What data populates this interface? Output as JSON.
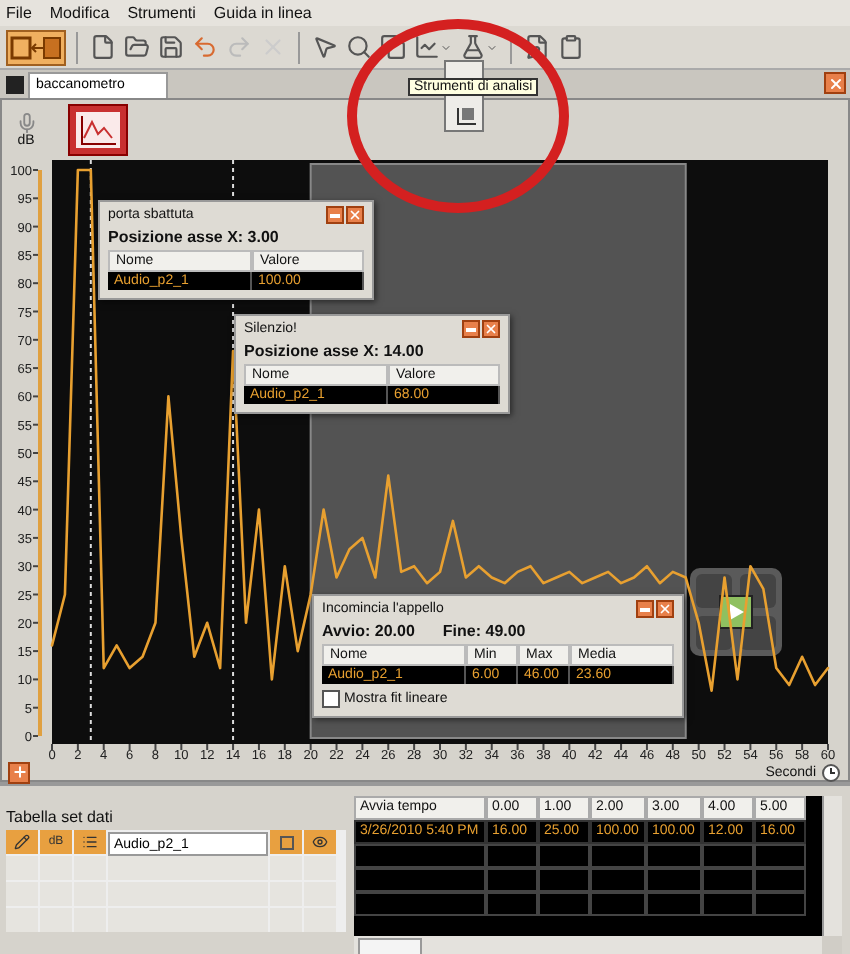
{
  "menu": [
    "File",
    "Modifica",
    "Strumenti",
    "Guida in linea"
  ],
  "toolbar": {
    "tooltip": "Strumenti di analisi"
  },
  "tabs": [
    {
      "label": "baccanometro",
      "selected": true
    }
  ],
  "chart": {
    "unit": "dB",
    "x_unit": "Secondi",
    "chart_data": {
      "type": "line",
      "x": [
        0,
        1,
        2,
        3,
        4,
        5,
        6,
        7,
        8,
        9,
        10,
        11,
        12,
        13,
        14,
        15,
        16,
        17,
        18,
        19,
        20,
        21,
        22,
        23,
        24,
        25,
        26,
        27,
        28,
        29,
        30,
        31,
        32,
        33,
        34,
        35,
        36,
        37,
        38,
        39,
        40,
        41,
        42,
        43,
        44,
        45,
        46,
        47,
        48,
        49,
        50,
        51,
        52,
        53,
        54,
        55,
        56,
        57,
        58,
        59,
        60
      ],
      "xlim": [
        0,
        60
      ],
      "ylim": [
        0,
        100
      ],
      "xticks": [
        0,
        2,
        4,
        6,
        8,
        10,
        12,
        14,
        16,
        18,
        20,
        22,
        24,
        26,
        28,
        30,
        32,
        34,
        36,
        38,
        40,
        42,
        44,
        46,
        48,
        50,
        52,
        54,
        56,
        58,
        60
      ],
      "yticks": [
        0,
        5,
        10,
        15,
        20,
        25,
        30,
        35,
        40,
        45,
        50,
        55,
        60,
        65,
        70,
        75,
        80,
        85,
        90,
        95,
        100
      ],
      "series": [
        {
          "color": "#e8a030",
          "values": [
            16,
            25,
            100,
            100,
            12,
            16,
            12,
            14,
            20,
            60,
            35,
            14,
            20,
            12,
            68,
            20,
            40,
            10,
            30,
            15,
            25,
            40,
            28,
            33,
            35,
            28,
            46,
            29,
            30,
            27,
            29,
            38,
            28,
            30,
            28,
            27,
            29,
            30,
            27,
            28,
            29,
            27,
            28,
            29,
            27,
            28,
            30,
            27,
            29,
            28,
            20,
            8,
            28,
            10,
            30,
            26,
            12,
            9,
            14,
            9,
            12
          ]
        }
      ],
      "ref_lines": [
        {
          "axis": "x",
          "value": 3
        },
        {
          "axis": "x",
          "value": 14
        }
      ],
      "bands": [
        {
          "axis": "x",
          "from": 20,
          "to": 49
        }
      ]
    }
  },
  "popups": [
    {
      "kind": "point",
      "title": "porta sbattuta",
      "heading": "Posizione asse X: 3.00",
      "columns": [
        "Nome",
        "Valore"
      ],
      "rows": [
        [
          "Audio_p2_1",
          "100.00"
        ]
      ]
    },
    {
      "kind": "point",
      "title": "Silenzio!",
      "heading": "Posizione asse X: 14.00",
      "columns": [
        "Nome",
        "Valore"
      ],
      "rows": [
        [
          "Audio_p2_1",
          "68.00"
        ]
      ]
    },
    {
      "kind": "range",
      "title": "Incomincia l'appello",
      "start": "Avvio: 20.00",
      "end": "Fine: 49.00",
      "columns": [
        "Nome",
        "Min",
        "Max",
        "Media"
      ],
      "rows": [
        [
          "Audio_p2_1",
          "6.00",
          "46.00",
          "23.60"
        ]
      ],
      "checkbox": {
        "label": "Mostra fit lineare",
        "checked": false
      }
    }
  ],
  "dataset_table": {
    "title": "Tabella set dati",
    "datasets": [
      {
        "name": "Audio_p2_1",
        "unit": "dB"
      }
    ],
    "columns": [
      "Avvia tempo",
      "0.00",
      "1.00",
      "2.00",
      "3.00",
      "4.00",
      "5.00"
    ],
    "rows": [
      [
        "3/26/2010 5:40 PM",
        "16.00",
        "25.00",
        "100.00",
        "100.00",
        "12.00",
        "16.00"
      ]
    ]
  }
}
